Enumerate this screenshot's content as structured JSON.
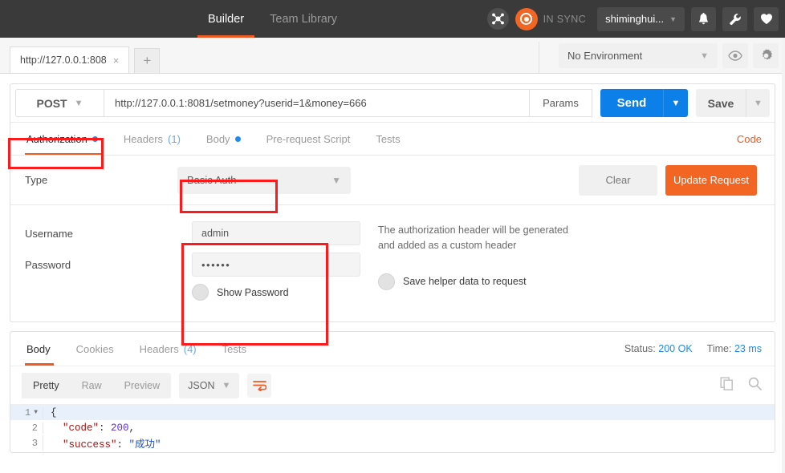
{
  "header": {
    "tabs": [
      {
        "label": "Builder",
        "active": true
      },
      {
        "label": "Team Library",
        "active": false
      }
    ],
    "sync_status": "IN SYNC",
    "user": "shiminghui...",
    "icons": {
      "network": "network-node-icon",
      "sync": "sync-status-icon",
      "bell": "bell-icon",
      "wrench": "wrench-icon",
      "heart": "heart-icon"
    }
  },
  "tabstrip": {
    "request_tab_label": "http://127.0.0.1:808",
    "close_glyph": "×",
    "new_tab_glyph": "+",
    "environment": "No Environment",
    "eye_icon": "eye-icon",
    "gear_icon": "gear-icon"
  },
  "request": {
    "method": "POST",
    "url": "http://127.0.0.1:8081/setmoney?userid=1&money=666",
    "params_label": "Params",
    "send_label": "Send",
    "save_label": "Save",
    "tabs": [
      {
        "label": "Authorization",
        "dot": true,
        "count": "",
        "active": true
      },
      {
        "label": "Headers",
        "dot": false,
        "count": "(1)",
        "active": false
      },
      {
        "label": "Body",
        "dot": true,
        "count": "",
        "active": false
      },
      {
        "label": "Pre-request Script",
        "dot": false,
        "count": "",
        "active": false
      },
      {
        "label": "Tests",
        "dot": false,
        "count": "",
        "active": false
      }
    ],
    "code_link": "Code"
  },
  "auth": {
    "type_label": "Type",
    "type_value": "Basic Auth",
    "clear_label": "Clear",
    "update_label": "Update Request",
    "username_label": "Username",
    "username_value": "admin",
    "password_label": "Password",
    "password_value": "••••••",
    "show_password_label": "Show Password",
    "help_line1": "The authorization header will be generated",
    "help_line2": "and added as a custom header",
    "save_helper_label": "Save helper data to request"
  },
  "response": {
    "tabs": [
      {
        "label": "Body",
        "count": "",
        "active": true
      },
      {
        "label": "Cookies",
        "count": "",
        "active": false
      },
      {
        "label": "Headers",
        "count": "(4)",
        "active": false
      },
      {
        "label": "Tests",
        "count": "",
        "active": false
      }
    ],
    "status_label": "Status:",
    "status_value": "200 OK",
    "time_label": "Time:",
    "time_value": "23 ms",
    "view_modes": [
      {
        "label": "Pretty",
        "active": true
      },
      {
        "label": "Raw",
        "active": false
      },
      {
        "label": "Preview",
        "active": false
      }
    ],
    "format": "JSON",
    "wrap_icon": "word-wrap-icon",
    "copy_icon": "copy-icon",
    "search_icon": "search-icon",
    "body_lines": [
      {
        "num": "1",
        "fold": true,
        "highlight": true,
        "tokens": [
          {
            "t": "{",
            "c": "tok-pun"
          }
        ]
      },
      {
        "num": "2",
        "fold": false,
        "highlight": false,
        "tokens": [
          {
            "t": "  \"code\"",
            "c": "tok-key"
          },
          {
            "t": ": ",
            "c": "tok-pun"
          },
          {
            "t": "200",
            "c": "tok-num"
          },
          {
            "t": ",",
            "c": "tok-pun"
          }
        ]
      },
      {
        "num": "3",
        "fold": false,
        "highlight": false,
        "tokens": [
          {
            "t": "  \"success\"",
            "c": "tok-key"
          },
          {
            "t": ": ",
            "c": "tok-pun"
          },
          {
            "t": "\"成功\"",
            "c": "tok-str"
          }
        ]
      }
    ]
  },
  "colors": {
    "accent_orange": "#ef5b25",
    "send_blue": "#0c7fe8",
    "update_orange": "#f26522",
    "annotation_red": "#fd1a1a",
    "header_dark": "#3a3a3a"
  }
}
